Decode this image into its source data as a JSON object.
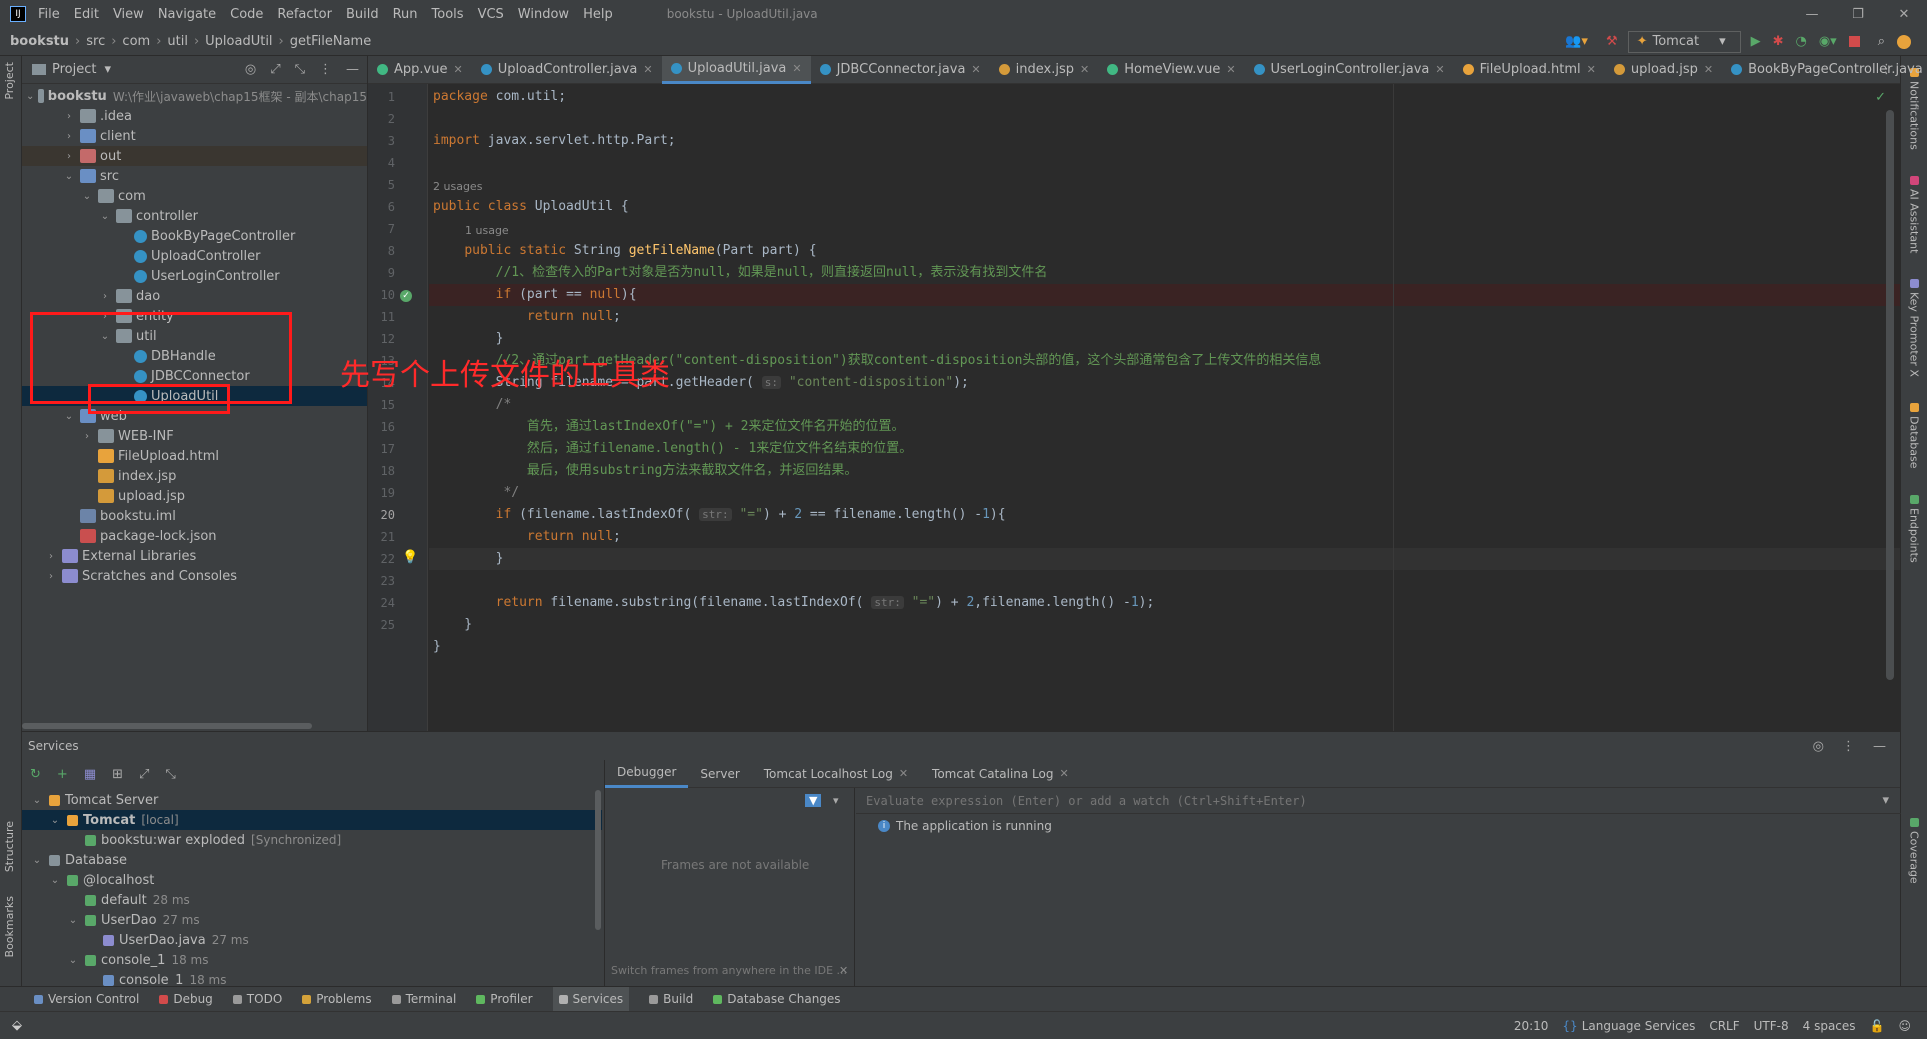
{
  "window": {
    "title": "bookstu - UploadUtil.java",
    "menu": [
      "File",
      "Edit",
      "View",
      "Navigate",
      "Code",
      "Refactor",
      "Build",
      "Run",
      "Tools",
      "VCS",
      "Window",
      "Help"
    ],
    "run_config": "Tomcat"
  },
  "breadcrumb": [
    "bookstu",
    "src",
    "com",
    "util",
    "UploadUtil",
    "getFileName"
  ],
  "left_strip": {
    "project": "Project",
    "structure": "Structure",
    "bookmarks": "Bookmarks"
  },
  "right_strip": [
    "Notifications",
    "AI Assistant",
    "Key Promoter X",
    "Database",
    "Endpoints",
    "Coverage"
  ],
  "project_panel": {
    "title": "Project",
    "root_label": "bookstu",
    "root_path": "W:\\作业\\javaweb\\chap15框架 - 副本\\chap15",
    "items": [
      {
        "label": "idea",
        "prefix": ".",
        "indent": 1,
        "arrow": "›",
        "icon": "folder"
      },
      {
        "label": "client",
        "indent": 1,
        "arrow": "›",
        "icon": "folder-blue"
      },
      {
        "label": "out",
        "indent": 1,
        "arrow": "›",
        "icon": "folder-orange"
      },
      {
        "label": "src",
        "indent": 1,
        "arrow": "⌄",
        "icon": "folder-blue"
      },
      {
        "label": "com",
        "indent": 2,
        "arrow": "⌄",
        "icon": "folder"
      },
      {
        "label": "controller",
        "indent": 3,
        "arrow": "⌄",
        "icon": "folder"
      },
      {
        "label": "BookByPageController",
        "indent": 4,
        "arrow": "",
        "icon": "class"
      },
      {
        "label": "UploadController",
        "indent": 4,
        "arrow": "",
        "icon": "class"
      },
      {
        "label": "UserLoginController",
        "indent": 4,
        "arrow": "",
        "icon": "class"
      },
      {
        "label": "dao",
        "indent": 3,
        "arrow": "›",
        "icon": "folder"
      },
      {
        "label": "entity",
        "indent": 3,
        "arrow": "›",
        "icon": "folder"
      },
      {
        "label": "util",
        "indent": 3,
        "arrow": "⌄",
        "icon": "folder"
      },
      {
        "label": "DBHandle",
        "indent": 4,
        "arrow": "",
        "icon": "class"
      },
      {
        "label": "JDBCConnector",
        "indent": 4,
        "arrow": "",
        "icon": "class"
      },
      {
        "label": "UploadUtil",
        "indent": 4,
        "arrow": "",
        "icon": "class"
      },
      {
        "label": "web",
        "indent": 1,
        "arrow": "⌄",
        "icon": "folder-blue"
      },
      {
        "label": "WEB-INF",
        "indent": 2,
        "arrow": "›",
        "icon": "folder"
      },
      {
        "label": "FileUpload.html",
        "indent": 2,
        "arrow": "",
        "icon": "html"
      },
      {
        "label": "index.jsp",
        "indent": 2,
        "arrow": "",
        "icon": "jsp"
      },
      {
        "label": "upload.jsp",
        "indent": 2,
        "arrow": "",
        "icon": "jsp"
      },
      {
        "label": "bookstu.iml",
        "indent": 1,
        "arrow": "",
        "icon": "iml"
      },
      {
        "label": "package-lock.json",
        "indent": 1,
        "arrow": "",
        "icon": "json"
      },
      {
        "label": "External Libraries",
        "indent": 0,
        "arrow": "›",
        "icon": "lib"
      },
      {
        "label": "Scratches and Consoles",
        "indent": 0,
        "arrow": "›",
        "icon": "lib"
      }
    ]
  },
  "tabs": [
    {
      "label": "App.vue",
      "color": "#41b883"
    },
    {
      "label": "UploadController.java",
      "color": "#3592c4"
    },
    {
      "label": "UploadUtil.java",
      "color": "#3592c4",
      "active": true
    },
    {
      "label": "JDBCConnector.java",
      "color": "#3592c4"
    },
    {
      "label": "index.jsp",
      "color": "#d49a3a"
    },
    {
      "label": "HomeView.vue",
      "color": "#41b883"
    },
    {
      "label": "UserLoginController.java",
      "color": "#3592c4"
    },
    {
      "label": "FileUpload.html",
      "color": "#e8a33c"
    },
    {
      "label": "upload.jsp",
      "color": "#d49a3a"
    },
    {
      "label": "BookByPageController.java",
      "color": "#3592c4"
    }
  ],
  "code": {
    "line_numbers": [
      "1",
      "2",
      "3",
      "4",
      "5",
      "6",
      "7",
      "8",
      "9",
      "10",
      "11",
      "12",
      "13",
      "14",
      "15",
      "16",
      "17",
      "18",
      "19",
      "20",
      "21",
      "22",
      "23",
      "24",
      "25"
    ],
    "usage_2": "2 usages",
    "usage_1": "1 usage",
    "hint_s": "s:",
    "hint_str": "str:",
    "comment_check": "//1、检查传入的Part对象是否为null，如果是null，则直接返回null，表示没有找到文件名",
    "comment_header": "//2、通过part.getHeader(\"content-disposition\")获取content-disposition头部的值，这个头部通常包含了上传文件的相关信息",
    "comment_a": "首先，通过lastIndexOf(\"=\") + 2来定位文件名开始的位置。",
    "comment_b": "然后，通过filename.length() - 1来定位文件名结束的位置。",
    "comment_c": "最后，使用substring方法来截取文件名，并返回结果。"
  },
  "services": {
    "title": "Services",
    "tree": [
      {
        "label": "Tomcat Server",
        "extra": "",
        "indent": 0
      },
      {
        "label": "Tomcat",
        "extra": "[local]",
        "indent": 1
      },
      {
        "label": "bookstu:war exploded",
        "extra": "[Synchronized]",
        "indent": 2
      },
      {
        "label": "Database",
        "extra": "",
        "indent": 0
      },
      {
        "label": "@localhost",
        "extra": "",
        "indent": 1
      },
      {
        "label": "default",
        "extra": "28 ms",
        "indent": 2
      },
      {
        "label": "UserDao",
        "extra": "27 ms",
        "indent": 2
      },
      {
        "label": "UserDao.java",
        "extra": "27 ms",
        "indent": 3
      },
      {
        "label": "console_1",
        "extra": "18 ms",
        "indent": 2
      },
      {
        "label": "console_1",
        "extra": "18 ms",
        "indent": 3
      }
    ],
    "debug_tabs": [
      "Debugger",
      "Server",
      "Tomcat Localhost Log",
      "Tomcat Catalina Log"
    ],
    "frames_empty": "Frames are not available",
    "switch_frames": "Switch frames from anywhere in the IDE ...",
    "eval_placeholder": "Evaluate expression (Enter) or add a watch (Ctrl+Shift+Enter)",
    "app_running": "The application is running"
  },
  "bottom_tools": [
    {
      "label": "Version Control",
      "color": "#6a8fc4"
    },
    {
      "label": "Debug",
      "color": "#d24b4b"
    },
    {
      "label": "TODO",
      "color": "#9a9a9a"
    },
    {
      "label": "Problems",
      "color": "#d4a23a"
    },
    {
      "label": "Terminal",
      "color": "#9a9a9a"
    },
    {
      "label": "Profiler",
      "color": "#5fb85f"
    },
    {
      "label": "Services",
      "color": "#b0b0b0",
      "active": true
    },
    {
      "label": "Build",
      "color": "#9a9a9a"
    },
    {
      "label": "Database Changes",
      "color": "#5fb85f"
    }
  ],
  "status": {
    "position": "20:10",
    "language_services": "Language Services",
    "line_sep": "CRLF",
    "encoding": "UTF-8",
    "indent": "4 spaces"
  },
  "annotation": {
    "text": "先写个上传文件的工具类",
    "color": "#ff2a2a"
  }
}
